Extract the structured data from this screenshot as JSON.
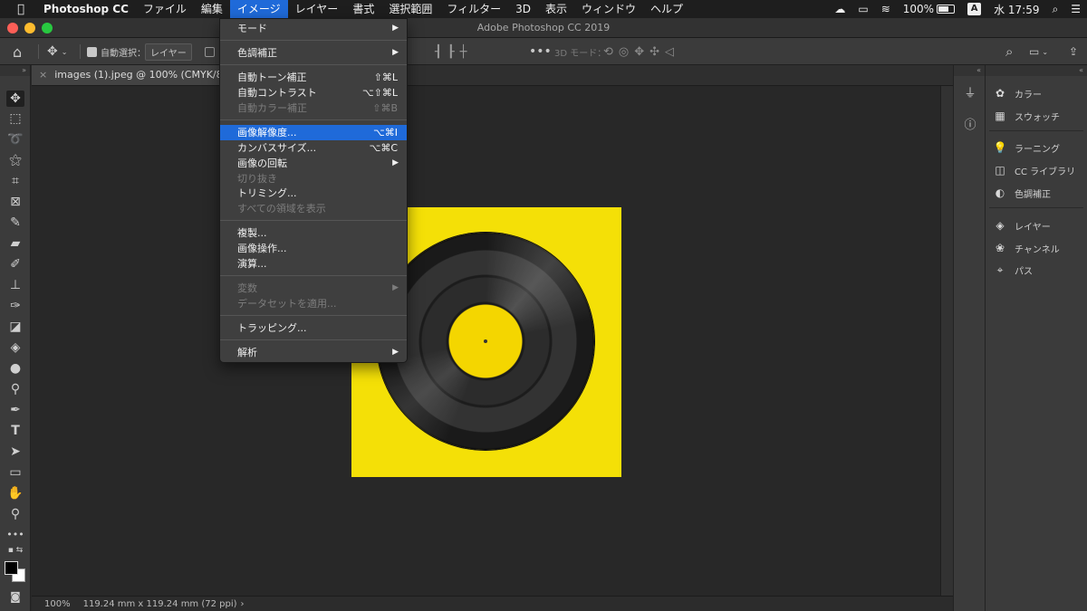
{
  "menubar": {
    "app": "Photoshop CC",
    "items": [
      "ファイル",
      "編集",
      "イメージ",
      "レイヤー",
      "書式",
      "選択範囲",
      "フィルター",
      "3D",
      "表示",
      "ウィンドウ",
      "ヘルプ"
    ],
    "active": "イメージ"
  },
  "status": {
    "battery": "100%",
    "input": "A",
    "clock": "水 17:59"
  },
  "window": {
    "title": "Adobe Photoshop CC 2019"
  },
  "options": {
    "auto_select_label": "自動選択：",
    "auto_select_value": "レイヤー",
    "threed_mode": "3D モード："
  },
  "document": {
    "tab_title": "images (1).jpeg @ 100% (CMYK/8) *",
    "zoom": "100%",
    "doc_size": "119.24 mm x 119.24 mm (72 ppi)"
  },
  "panels": [
    "カラー",
    "スウォッチ",
    "ラーニング",
    "CC ライブラリ",
    "色調補正",
    "レイヤー",
    "チャンネル",
    "パス"
  ],
  "image_menu": {
    "mode": "モード",
    "adjustments": "色調補正",
    "auto_tone": "自動トーン補正",
    "auto_tone_sc": "⇧⌘L",
    "auto_contrast": "自動コントラスト",
    "auto_contrast_sc": "⌥⇧⌘L",
    "auto_color": "自動カラー補正",
    "auto_color_sc": "⇧⌘B",
    "image_size": "画像解像度...",
    "image_size_sc": "⌥⌘I",
    "canvas_size": "カンバスサイズ...",
    "canvas_size_sc": "⌥⌘C",
    "rotation": "画像の回転",
    "crop": "切り抜き",
    "trim": "トリミング...",
    "reveal_all": "すべての領域を表示",
    "duplicate": "複製...",
    "apply_image": "画像操作...",
    "calculations": "演算...",
    "variables": "変数",
    "apply_dataset": "データセットを適用...",
    "trapping": "トラッピング...",
    "analysis": "解析"
  }
}
